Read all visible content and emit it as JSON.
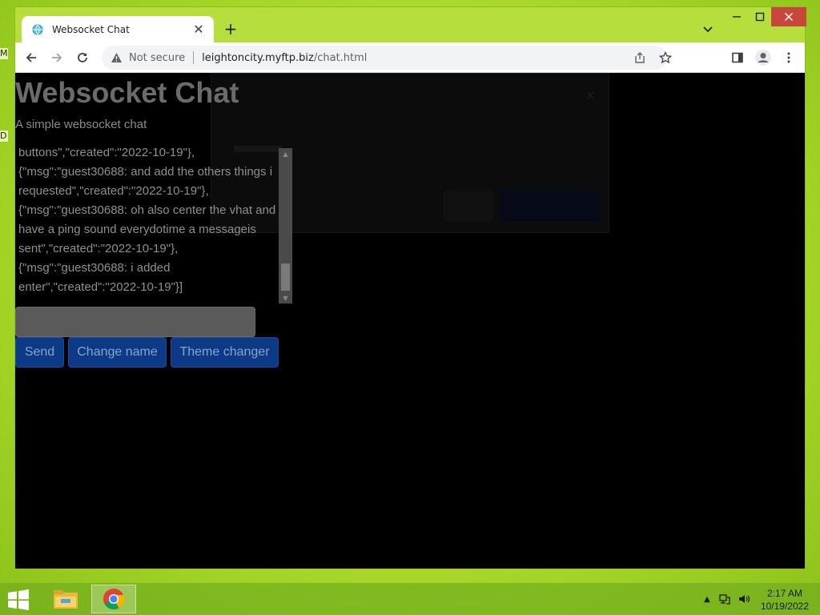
{
  "desktop": {
    "edge_labels": [
      "M",
      "D"
    ]
  },
  "browser": {
    "tab_title": "Websocket Chat",
    "address": {
      "security": "Not secure",
      "host": "leightoncity.myftp.biz",
      "path": "/chat.html"
    }
  },
  "page": {
    "title": "Websocket Chat",
    "subtitle": "A simple websocket chat",
    "chat_log": "buttons\",\"created\":\"2022-10-19\"},{\"msg\":\"guest30688: and add the others things i requested\",\"created\":\"2022-10-19\"},{\"msg\":\"guest30688: oh also center the vhat and have a ping sound everydotime a messageis sent\",\"created\":\"2022-10-19\"},{\"msg\":\"guest30688: i added enter\",\"created\":\"2022-10-19\"}]",
    "message_input": {
      "value": "",
      "placeholder": ""
    },
    "buttons": {
      "send": "Send",
      "change_name": "Change name",
      "theme_changer": "Theme changer"
    }
  },
  "taskbar": {
    "apps": [
      "file-explorer",
      "chrome"
    ],
    "clock": {
      "time": "2:17 AM",
      "date": "10/19/2022"
    }
  },
  "colors": {
    "desktop": "#b4e02e",
    "page_background": "#000000",
    "button": "#0d3a86",
    "close_button": "#c9463d"
  }
}
